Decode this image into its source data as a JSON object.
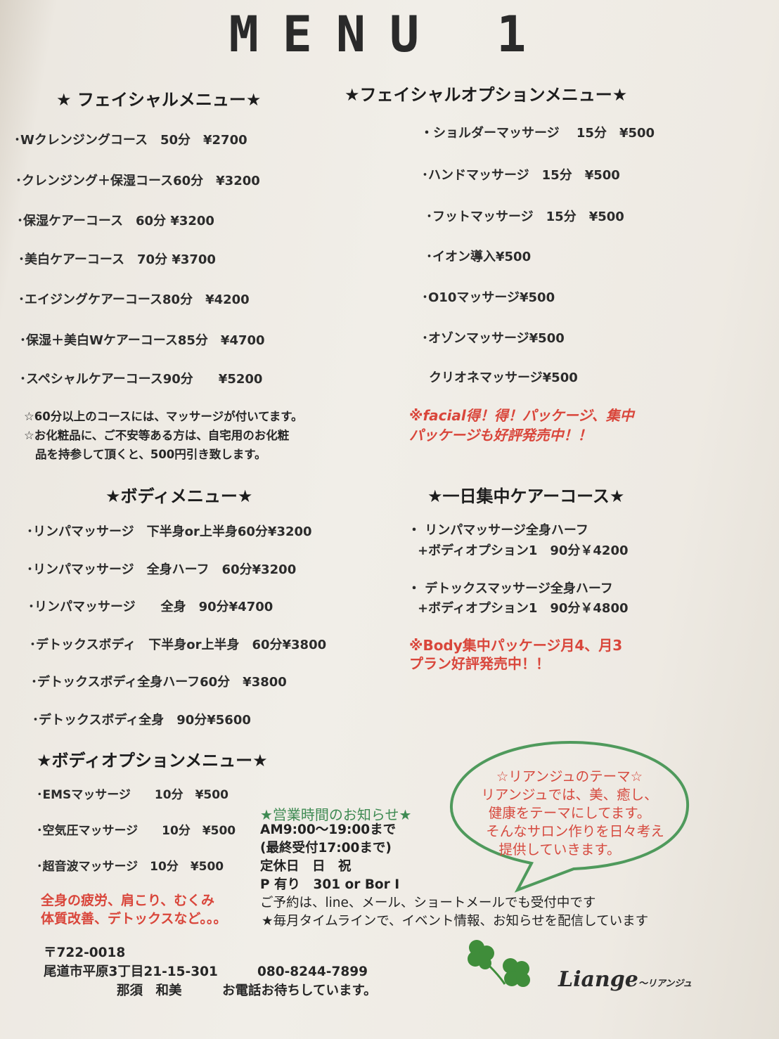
{
  "title": "MENU 1",
  "facial": {
    "heading": "★ フェイシャルメニュー★",
    "items": [
      "･Wクレンジングコース　50分　¥2700",
      "･クレンジング＋保湿コース60分　¥3200",
      "･保湿ケアーコース　60分 ¥3200",
      "･美白ケアーコース　70分 ¥3700",
      "･エイジングケアーコース80分　¥4200",
      "･保湿＋美白Wケアーコース85分　¥4700",
      "･スペシャルケアーコース90分　　¥5200"
    ],
    "notes": [
      "☆60分以上のコースには、マッサージが付いてます。",
      "☆お化粧品に、ご不安等ある方は、自宅用のお化粧",
      "品を持参して頂くと、500円引き致します。"
    ]
  },
  "facial_option": {
    "heading": "★フェイシャルオプションメニュー★",
    "items": [
      "・ショルダーマッサージ　 15分　¥500",
      "･ハンドマッサージ　15分　¥500",
      "･フットマッサージ　15分　¥500",
      "･イオン導入¥500",
      "･O10マッサージ¥500",
      "･オゾンマッサージ¥500",
      "クリオネマッサージ¥500"
    ],
    "promo": [
      "※facial得！得！パッケージ、集中",
      "パッケージも好評発売中！！"
    ]
  },
  "body": {
    "heading": "★ボディメニュー★",
    "items": [
      "･リンパマッサージ　下半身or上半身60分¥3200",
      "･リンパマッサージ　全身ハーフ　60分¥3200",
      "･リンパマッサージ　　全身　90分¥4700",
      "･デトックスボディ　下半身or上半身　60分¥3800",
      "･デトックスボディ全身ハーフ60分　¥3800",
      "･デトックスボディ全身　90分¥5600"
    ]
  },
  "intensive": {
    "heading": "★一日集中ケアーコース★",
    "items": [
      {
        "line1": "・ リンパマッサージ全身ハーフ",
        "line2": "+ボディオプション1　90分￥4200"
      },
      {
        "line1": "・ デトックスマッサージ全身ハーフ",
        "line2": "+ボディオプション1　90分￥4800"
      }
    ],
    "promo": [
      "※Body集中パッケージ月4、月3",
      "プラン好評発売中！！"
    ]
  },
  "body_option": {
    "heading": "★ボディオプションメニュー★",
    "items": [
      "･EMSマッサージ　　10分　¥500",
      "･空気圧マッサージ　　10分　¥500",
      "･超音波マッサージ　10分　¥500"
    ],
    "promo": [
      "全身の疲労、肩こり、むくみ",
      "体質改善、デトックスなど。。。"
    ]
  },
  "hours": {
    "heading": "★営業時間のお知らせ★",
    "lines": [
      "AM9:00〜19:00まで",
      "(最終受付17:00まで)",
      "定休日　日　祝",
      "P 有り　301 or Bor I",
      "ご予約は、line、メール、ショートメールでも受付中です",
      "★毎月タイムラインで、イベント情報、お知らせを配信しています"
    ]
  },
  "theme": {
    "lines": [
      "☆リアンジュのテーマ☆",
      "リアンジュでは、美、癒し、",
      "健康をテーマにしてます。",
      "そんなサロン作りを日々考え",
      "提供していきます。"
    ]
  },
  "contact": {
    "postal": "〒722-0018",
    "address": "尾道市平原3丁目21-15-301",
    "phone": "080-8244-7899",
    "name": "那須　和美",
    "message": "お電話お待ちしています。"
  },
  "logo": {
    "text": "Liange",
    "sub": "〜リアンジュ"
  },
  "colors": {
    "promo_red": "#d9463b",
    "hours_green": "#3e8a52",
    "bubble_outline": "#4f9a5c",
    "clover_green": "#3f8d3a"
  }
}
